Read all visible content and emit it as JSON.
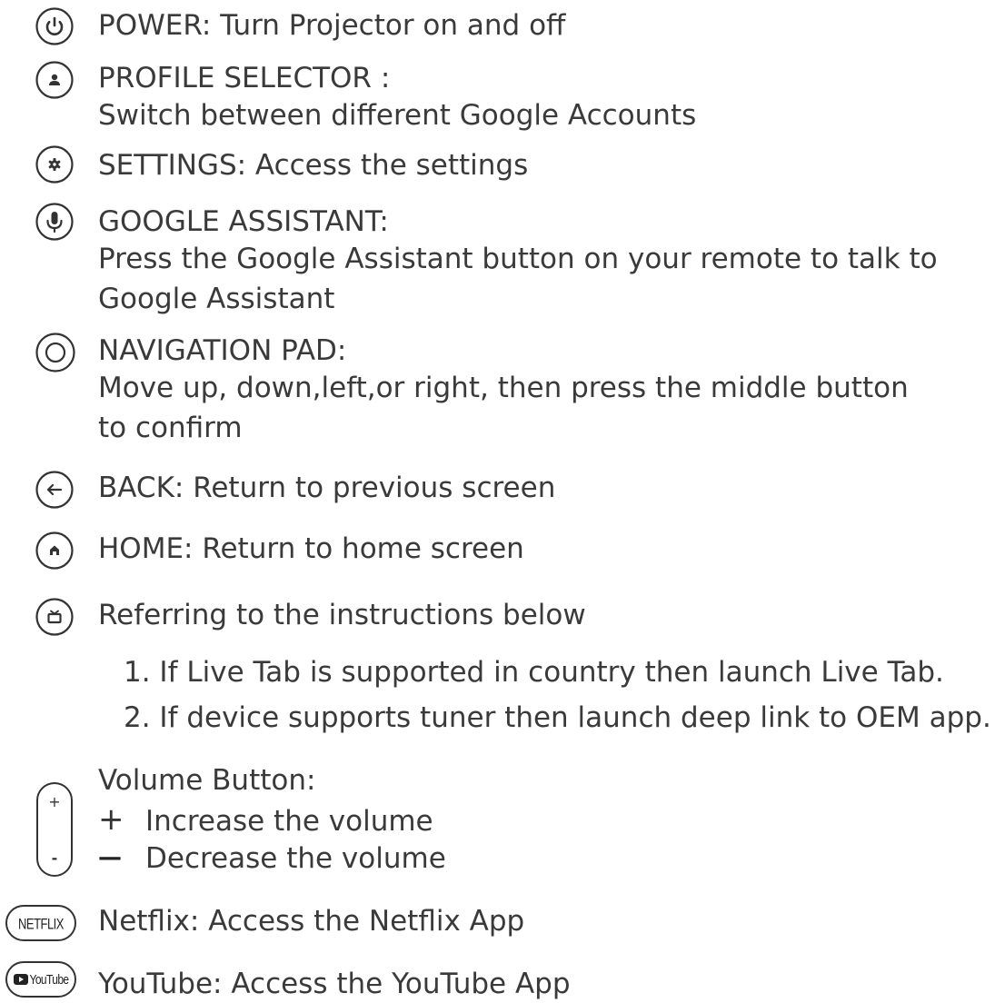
{
  "buttons": {
    "power": {
      "icon": "power-icon",
      "text": "POWER: Turn Projector on and off"
    },
    "profile": {
      "icon": "profile-icon",
      "line1": "PROFILE SELECTOR :",
      "line2": "Switch between different Google Accounts"
    },
    "settings": {
      "icon": "gear-icon",
      "text": "SETTINGS: Access the settings"
    },
    "assistant": {
      "icon": "microphone-icon",
      "line1": "GOOGLE ASSISTANT:",
      "line2": "Press the Google Assistant button on your remote to talk to",
      "line3": "Google Assistant"
    },
    "navigation": {
      "icon": "navigation-pad-icon",
      "line1": "NAVIGATION PAD:",
      "line2": "Move up, down,left,or right, then press the middle button",
      "line3": "to confirm"
    },
    "back": {
      "icon": "back-arrow-icon",
      "text": "BACK: Return to previous screen"
    },
    "home": {
      "icon": "home-icon",
      "text": "HOME: Return to home screen"
    },
    "live": {
      "icon": "tv-icon",
      "text": "Referring to the instructions below",
      "items": [
        "1. If Live Tab is supported in country then launch Live Tab.",
        "2. If device supports tuner then launch deep link to OEM app."
      ]
    },
    "volume": {
      "icon": "volume-rocker-icon",
      "plus_glyph": "+",
      "minus_glyph": "-",
      "title": "Volume Button:",
      "increase_sign": "+",
      "increase": "Increase the volume",
      "decrease_sign": "—",
      "decrease": "Decrease the volume"
    },
    "netflix": {
      "icon": "netflix-icon",
      "badge": "NETFLIX",
      "text": "Netflix: Access the Netflix App"
    },
    "youtube": {
      "icon": "youtube-icon",
      "badge": "YouTube",
      "text": "YouTube: Access the YouTube App"
    }
  }
}
